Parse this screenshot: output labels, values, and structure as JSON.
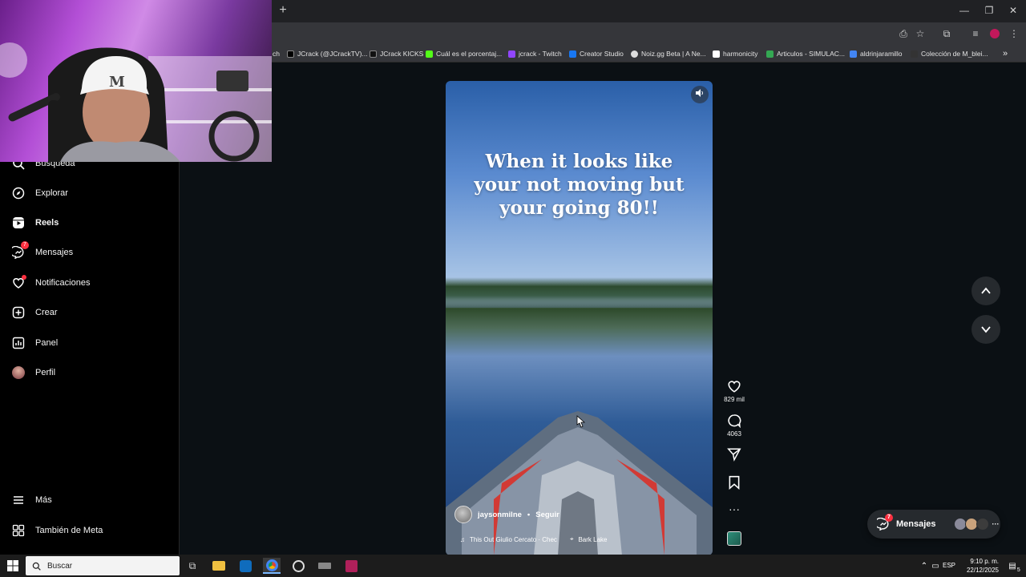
{
  "browser": {
    "newtab_glyph": "+",
    "window": {
      "minimize": "—",
      "restore": "❐",
      "close": "✕"
    },
    "bookmarks": [
      {
        "label": "ch",
        "color": "#9146ff"
      },
      {
        "label": "JCrack (@JCrackTV)...",
        "color": "#ffffff"
      },
      {
        "label": "JCrack KICKS",
        "color": "#ffffff"
      },
      {
        "label": "Cuál es el porcentaj...",
        "color": "#53fc18"
      },
      {
        "label": "jcrack - Twitch",
        "color": "#9146ff"
      },
      {
        "label": "Creator Studio",
        "color": "#1877f2"
      },
      {
        "label": "Noiz.gg Beta | A Ne...",
        "color": "#dddddd"
      },
      {
        "label": "harmonicity",
        "color": "#ffffff"
      },
      {
        "label": "Articulos - SIMULAC...",
        "color": "#34a853"
      },
      {
        "label": "aldrinjaramillo",
        "color": "#4285f4"
      },
      {
        "label": "Colección de M_blei...",
        "color": "#333333"
      }
    ],
    "overflow": "»"
  },
  "sidebar": {
    "items": [
      {
        "label": "Busqueda",
        "icon": "search-icon"
      },
      {
        "label": "Explorar",
        "icon": "compass-icon"
      },
      {
        "label": "Reels",
        "icon": "reels-icon"
      },
      {
        "label": "Mensajes",
        "icon": "messenger-icon",
        "badge": "7"
      },
      {
        "label": "Notificaciones",
        "icon": "heart-icon"
      },
      {
        "label": "Crear",
        "icon": "plus-square-icon"
      },
      {
        "label": "Panel",
        "icon": "chart-icon"
      },
      {
        "label": "Perfil",
        "icon": "avatar"
      }
    ],
    "bottom": [
      {
        "label": "Más",
        "icon": "menu-icon"
      },
      {
        "label": "También de Meta",
        "icon": "meta-grid-icon"
      }
    ]
  },
  "reel": {
    "caption": "When it looks like your not moving but your going 80!!",
    "author": "jaysonmilne",
    "separator": "•",
    "follow": "Seguir",
    "music": "This Out  Giulio Cercato · Chec",
    "location": "Bark Lake",
    "likes": "829 mil",
    "comments": "4063"
  },
  "messages_pill": {
    "label": "Mensajes",
    "badge": "7",
    "more": "···"
  },
  "taskbar": {
    "search_placeholder": "Buscar",
    "lang": "ESP",
    "time": "9:10 p. m.",
    "date": "22/12/2025",
    "notifications": "5"
  },
  "colors": {
    "accent_red": "#ff3040",
    "bg": "#0b1014",
    "sidebar": "#000000"
  }
}
